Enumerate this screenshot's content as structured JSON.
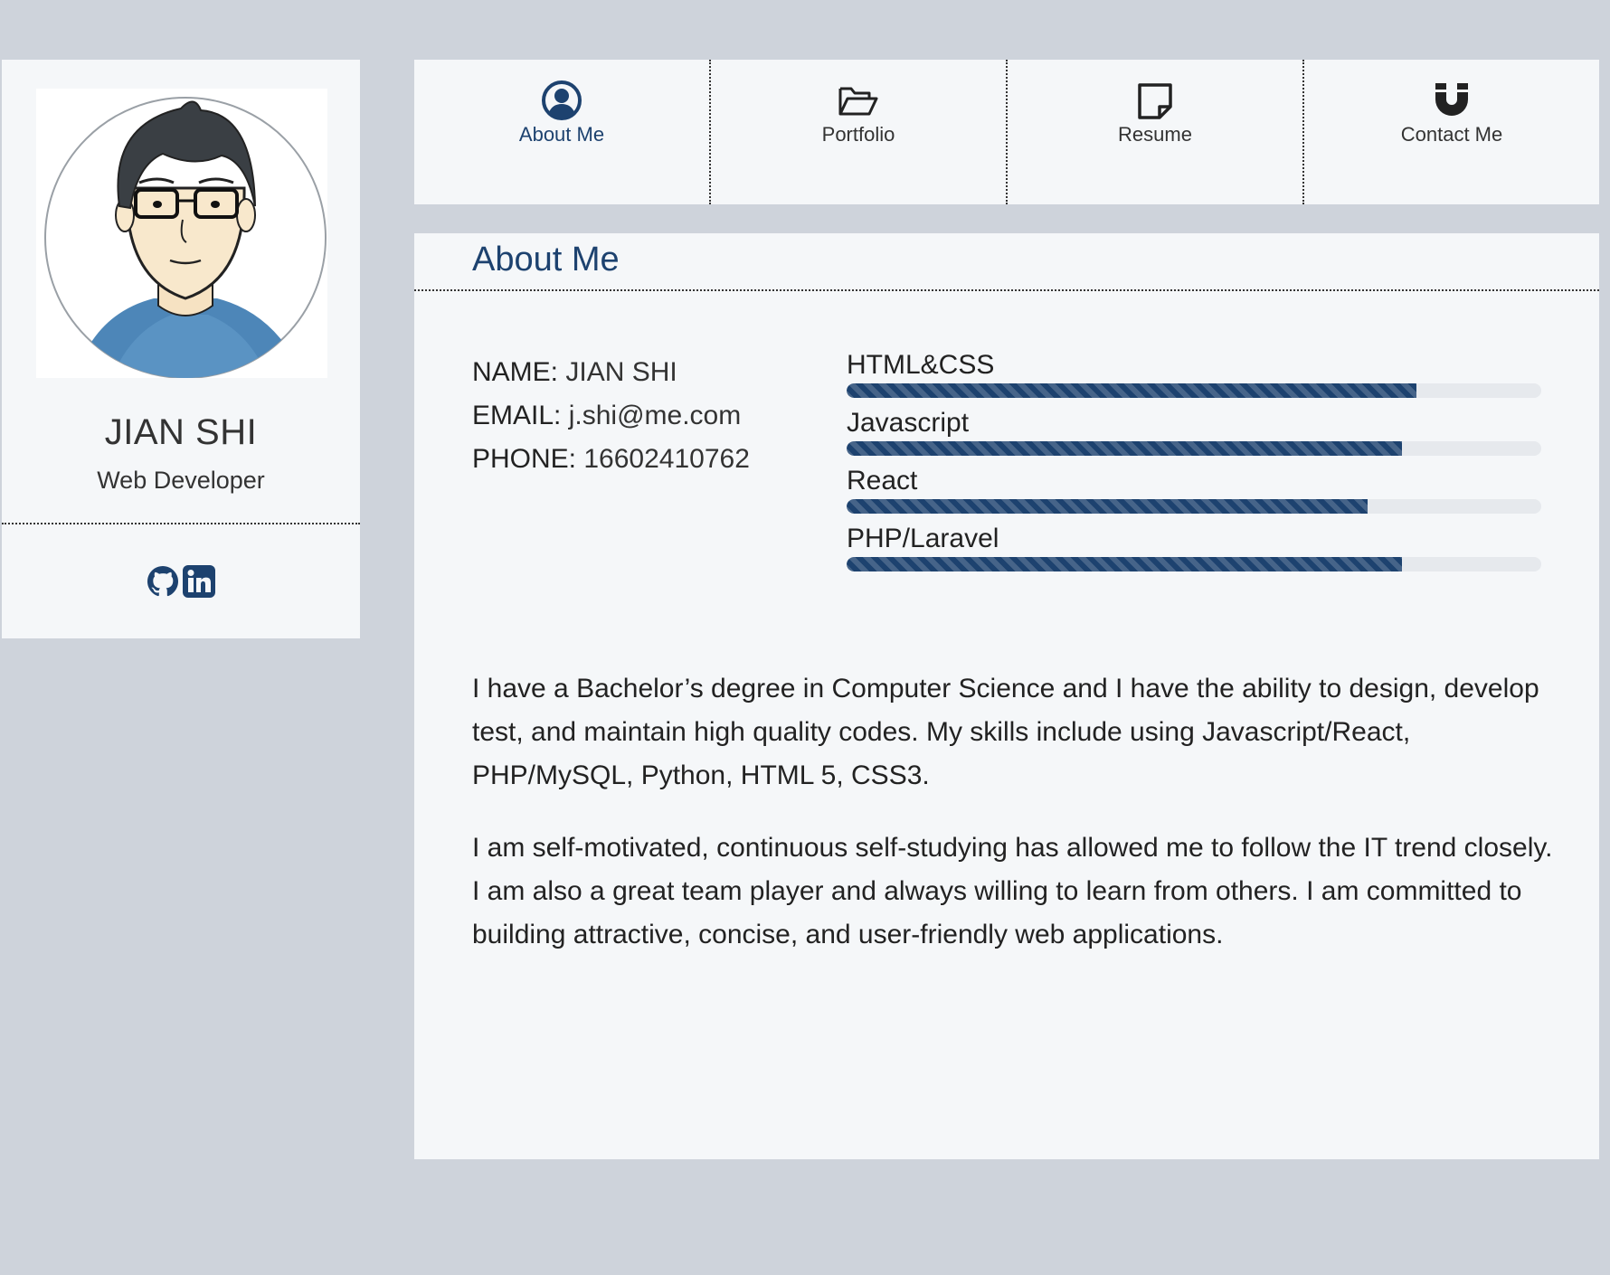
{
  "profile": {
    "name": "JIAN SHI",
    "role": "Web Developer",
    "avatar_icon": "cartoon-avatar",
    "social": [
      {
        "icon": "github-icon"
      },
      {
        "icon": "linkedin-icon"
      }
    ]
  },
  "nav": {
    "items": [
      {
        "label": "About Me",
        "icon": "user-circle-icon",
        "active": true
      },
      {
        "label": "Portfolio",
        "icon": "folder-open-icon",
        "active": false
      },
      {
        "label": "Resume",
        "icon": "sticky-note-icon",
        "active": false
      },
      {
        "label": "Contact Me",
        "icon": "magnet-icon",
        "active": false
      }
    ]
  },
  "about": {
    "title": "About Me",
    "info": [
      {
        "key": "NAME:",
        "value": "JIAN SHI"
      },
      {
        "key": "EMAIL:",
        "value": "j.shi@me.com"
      },
      {
        "key": "PHONE:",
        "value": "16602410762"
      }
    ],
    "skills": [
      {
        "name": "HTML&CSS",
        "level": 0.82
      },
      {
        "name": "Javascript",
        "level": 0.8
      },
      {
        "name": "React",
        "level": 0.75
      },
      {
        "name": "PHP/Laravel",
        "level": 0.8
      }
    ],
    "bio": [
      "I have a Bachelor’s degree in Computer Science and I have the ability to design, develop test, and maintain high quality codes. My skills include using Javascript/React, PHP/MySQL, Python, HTML 5, CSS3.",
      "I am self-motivated, continuous self-studying has allowed me to follow the IT trend closely. I am also a great team player and always willing to learn from others. I am committed to building attractive, concise, and user-friendly web applications."
    ]
  },
  "colors": {
    "accent": "#1d426f",
    "background": "#ced3db",
    "card": "#f5f7f9",
    "text": "#333333"
  }
}
